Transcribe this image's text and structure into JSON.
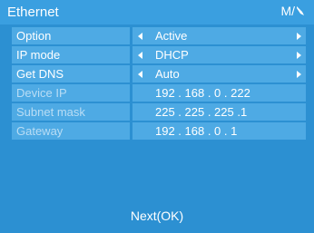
{
  "header": {
    "title": "Ethernet",
    "mode": "M/"
  },
  "rows": [
    {
      "label": "Option",
      "value": "Active"
    },
    {
      "label": "IP mode",
      "value": "DHCP"
    },
    {
      "label": "Get DNS",
      "value": "Auto"
    },
    {
      "label": "Device IP",
      "value": "192 . 168 . 0 . 222"
    },
    {
      "label": "Subnet mask",
      "value": "225 . 225 . 225 .1"
    },
    {
      "label": "Gateway",
      "value": "192 . 168 . 0 . 1"
    }
  ],
  "footer": {
    "next_label": "Next(OK)"
  },
  "colors": {
    "background": "#2c90d2",
    "header": "#3a9fe0",
    "cell": "#4eaae4"
  },
  "icons": {
    "mode": "pen-icon",
    "prev": "triangle-left-icon",
    "next": "triangle-right-icon"
  }
}
